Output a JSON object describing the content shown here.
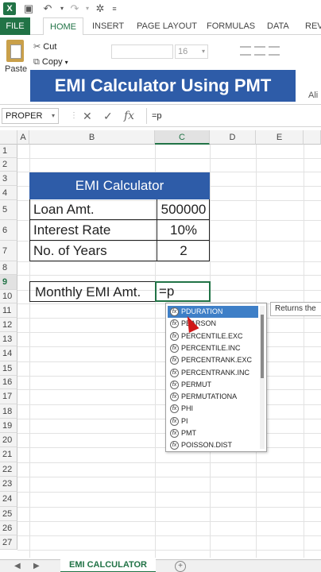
{
  "ribbon": {
    "tabs": [
      "FILE",
      "HOME",
      "INSERT",
      "PAGE LAYOUT",
      "FORMULAS",
      "DATA",
      "REV"
    ],
    "paste_label": "Paste",
    "cut_label": "Cut",
    "copy_label": "Copy",
    "font_size": "16",
    "ali_fragment": "Ali"
  },
  "banner": {
    "title": "EMI Calculator Using PMT"
  },
  "formula_bar": {
    "name_box": "PROPER",
    "formula": "=p"
  },
  "grid": {
    "columns": [
      "A",
      "B",
      "C",
      "D",
      "E"
    ],
    "active_column": "C",
    "rows": [
      "1",
      "2",
      "3",
      "4",
      "5",
      "6",
      "7",
      "8",
      "9",
      "10",
      "11",
      "12",
      "13",
      "14",
      "15",
      "16",
      "17",
      "18",
      "19",
      "20",
      "21",
      "22",
      "23",
      "24",
      "25",
      "26",
      "27"
    ],
    "active_row": "9"
  },
  "table": {
    "header": "EMI Calculator",
    "rows": [
      {
        "label": "Loan Amt.",
        "value": "500000"
      },
      {
        "label": "Interest Rate",
        "value": "10%"
      },
      {
        "label": "No. of Years",
        "value": "2"
      }
    ]
  },
  "emi": {
    "label": "Monthly EMI Amt.",
    "value": "=p"
  },
  "autocomplete": {
    "items": [
      "PDURATION",
      "PEARSON",
      "PERCENTILE.EXC",
      "PERCENTILE.INC",
      "PERCENTRANK.EXC",
      "PERCENTRANK.INC",
      "PERMUT",
      "PERMUTATIONA",
      "PHI",
      "PI",
      "PMT",
      "POISSON.DIST"
    ],
    "selected_index": 0,
    "tooltip": "Returns the"
  },
  "sheets": {
    "active": "EMI CALCULATOR"
  }
}
